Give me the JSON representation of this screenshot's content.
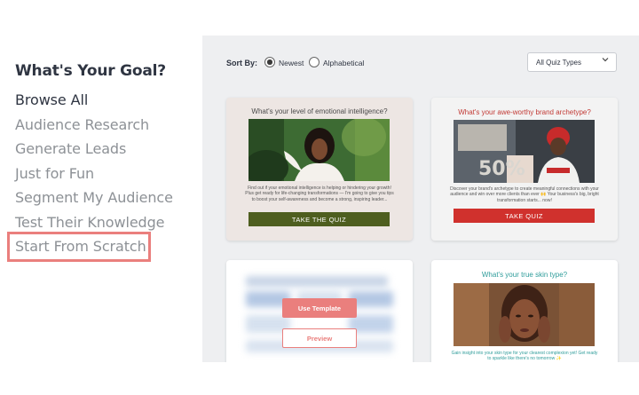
{
  "sidebar": {
    "title": "What's Your Goal?",
    "items": [
      {
        "label": "Browse All"
      },
      {
        "label": "Audience Research"
      },
      {
        "label": "Generate Leads"
      },
      {
        "label": "Just for Fun"
      },
      {
        "label": "Segment My Audience"
      },
      {
        "label": "Test Their Knowledge"
      },
      {
        "label": "Start From Scratch"
      }
    ],
    "active_item": "Browse All",
    "highlighted_item": "Start From Scratch",
    "highlight_color": "#ea7f7d"
  },
  "toolbar": {
    "sort_label": "Sort By:",
    "sort_options": [
      {
        "label": "Newest",
        "selected": true
      },
      {
        "label": "Alphabetical",
        "selected": false
      }
    ],
    "type_select": {
      "value": "All Quiz Types",
      "icon": "chevron-down-icon"
    }
  },
  "cards": [
    {
      "question": "What's your level of emotional intelligence?",
      "description": "Find out if your emotional intelligence is helping or hindering your growth! Plus get ready for life-changing transformations — I'm going to give you tips to boost your self-awareness and become a strong, inspiring leader...",
      "button": "TAKE THE QUIZ",
      "button_color": "#4e5e1f",
      "bg_color": "#ede6e3"
    },
    {
      "question": "What's your awe-worthy brand archetype?",
      "description": "Discover your brand's archetype to create meaningful connections with your audience and win over more clients than ever 🙌 Your business's big, bright transformation starts... now!",
      "button": "TAKE QUIZ",
      "button_color": "#d0312d",
      "accent_color": "#c23a35"
    },
    {
      "buttons": {
        "use_template": "Use Template",
        "preview": "Preview"
      },
      "accent_color": "#ea7f7d"
    },
    {
      "question": "What's your true skin type?",
      "description": "Gain insight into your skin type for your clearest complexion yet! Get ready to sparkle like there's no tomorrow ✨",
      "accent_color": "#2e9c9a"
    }
  ]
}
